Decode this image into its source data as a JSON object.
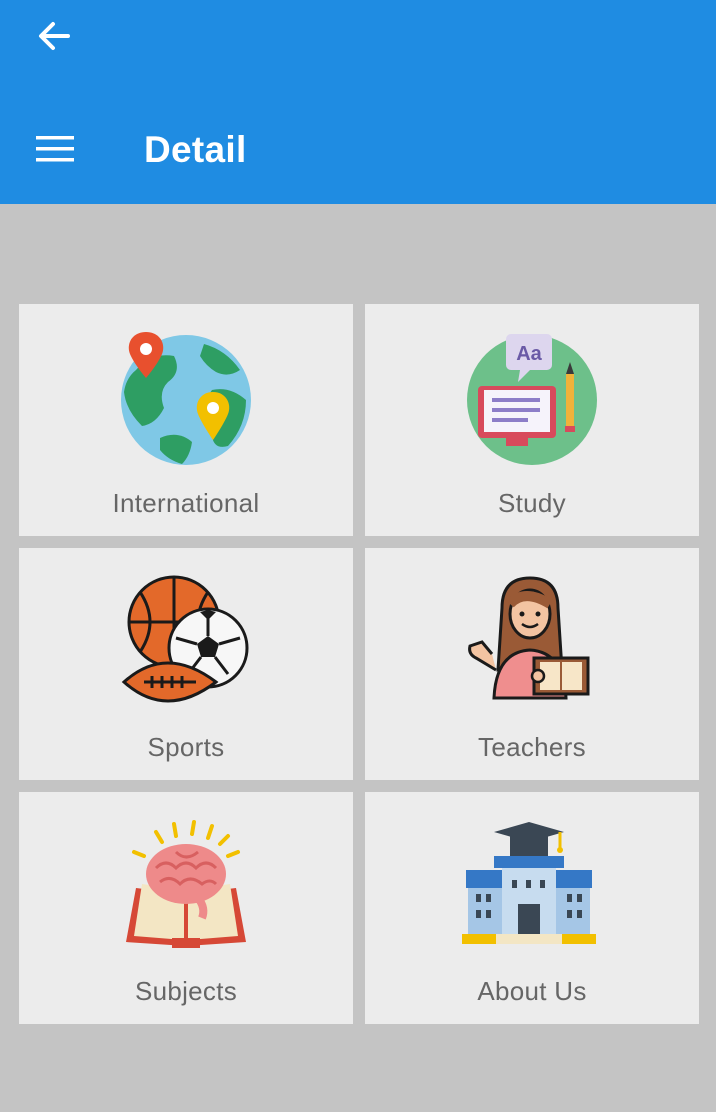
{
  "appbar": {
    "title": "Detail",
    "back_icon": "arrow-left-icon",
    "menu_icon": "hamburger-menu-icon",
    "color": "#1f8ce2"
  },
  "grid": {
    "items": [
      {
        "label": "International",
        "icon": "globe-icon"
      },
      {
        "label": "Study",
        "icon": "open-book-icon"
      },
      {
        "label": "Sports",
        "icon": "sports-balls-icon"
      },
      {
        "label": "Teachers",
        "icon": "teacher-icon"
      },
      {
        "label": "Subjects",
        "icon": "brain-book-icon"
      },
      {
        "label": "About Us",
        "icon": "school-building-icon"
      }
    ]
  }
}
